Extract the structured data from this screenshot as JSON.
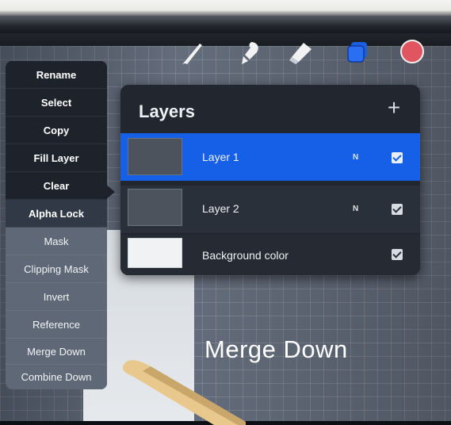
{
  "toolbar": {
    "tools": [
      "brush-icon",
      "smudge-icon",
      "eraser-icon",
      "layers-icon",
      "color-swatch"
    ],
    "color": "#e0555f",
    "layers_accent": "#1a5fe0"
  },
  "menu": {
    "items": [
      {
        "label": "Rename"
      },
      {
        "label": "Select"
      },
      {
        "label": "Copy"
      },
      {
        "label": "Fill Layer"
      },
      {
        "label": "Clear"
      },
      {
        "label": "Alpha Lock"
      },
      {
        "label": "Mask"
      },
      {
        "label": "Clipping Mask"
      },
      {
        "label": "Invert"
      },
      {
        "label": "Reference"
      },
      {
        "label": "Merge Down"
      },
      {
        "label": "Combine Down"
      }
    ]
  },
  "layers": {
    "title": "Layers",
    "add_symbol": "+",
    "rows": [
      {
        "name": "Layer 1",
        "blend": "N",
        "visible": true,
        "selected": true
      },
      {
        "name": "Layer 2",
        "blend": "N",
        "visible": true,
        "selected": false
      },
      {
        "name": "Background color",
        "blend": "",
        "visible": true,
        "selected": false
      }
    ],
    "accent": "#1560e6"
  },
  "caption": "Merge Down"
}
